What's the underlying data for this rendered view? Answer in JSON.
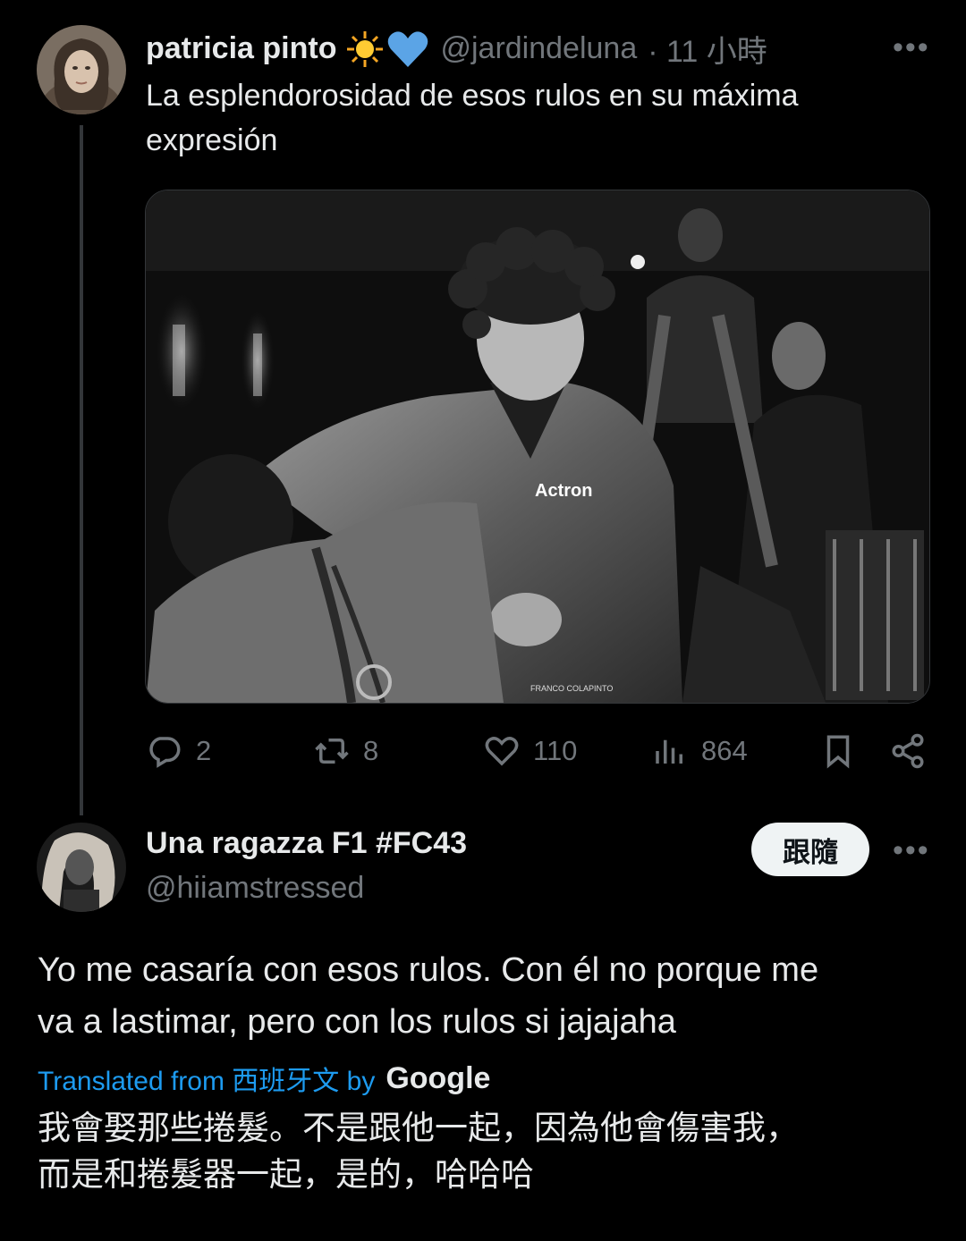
{
  "tweet": {
    "author_name": "patricia pinto",
    "author_emoji": "🌟",
    "author_heart": "💙",
    "handle": "@jardindeluna",
    "time": "· 11 小時",
    "more": "•••",
    "text_line1": "La esplendorosidad  de esos rulos en su máxima",
    "text_line2": "expresión",
    "photo": {
      "suit_brand": "Actron",
      "suit_name": "FRANCO COLAPINTO"
    },
    "actions": {
      "replies": "2",
      "reposts": "8",
      "likes": "110",
      "views": "864"
    }
  },
  "reply": {
    "author_name": "Una ragazza F1 #FC43",
    "handle": "@hiiamstressed",
    "follow_label": "跟隨",
    "more": "•••",
    "text_line1": "Yo me casaría con esos rulos. Con él no porque me",
    "text_line2": "va a lastimar, pero con los rulos si jajajaha",
    "translated_from": "Translated from 西班牙文 by",
    "translator": "Google",
    "translation_line1": "我會娶那些捲髮。不是跟他一起，因為他會傷害我，",
    "translation_line2": "而是和捲髮器一起，是的，哈哈哈"
  },
  "colors": {
    "background": "#000000",
    "text": "#e7e9ea",
    "secondary": "#71767b",
    "link": "#1d9bf0",
    "heart": "#5ba4e6"
  }
}
